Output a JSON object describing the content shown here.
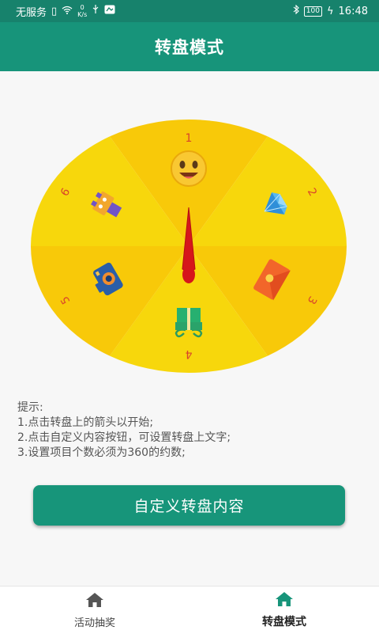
{
  "status_bar": {
    "carrier": "无服务",
    "net_speed_value": "0",
    "net_speed_unit": "K/s",
    "battery": "100",
    "time": "16:48"
  },
  "header": {
    "title": "转盘模式"
  },
  "wheel": {
    "segments": [
      {
        "number": "1",
        "icon": "smiley-face-icon"
      },
      {
        "number": "2",
        "icon": "diamond-icon"
      },
      {
        "number": "3",
        "icon": "red-envelope-icon"
      },
      {
        "number": "4",
        "icon": "gift-box-icon"
      },
      {
        "number": "5",
        "icon": "camera-icon"
      },
      {
        "number": "6",
        "icon": "toy-robot-icon"
      }
    ],
    "colors": {
      "light": "#f7d70c",
      "dark": "#f8c909",
      "label": "#d9452a",
      "pointer": "#d6161b"
    }
  },
  "tips": {
    "heading": "提示:",
    "line1": "1.点击转盘上的箭头以开始;",
    "line2": "2.点击自定义内容按钮，可设置转盘上文字;",
    "line3": "3.设置项目个数必须为360的约数;"
  },
  "custom_button": {
    "label": "自定义转盘内容"
  },
  "bottom_nav": {
    "items": [
      {
        "label": "活动抽奖",
        "icon": "home-icon",
        "active": false
      },
      {
        "label": "转盘模式",
        "icon": "home-icon",
        "active": true
      }
    ]
  },
  "theme": {
    "primary": "#17947a",
    "status_bar": "#17826c"
  }
}
